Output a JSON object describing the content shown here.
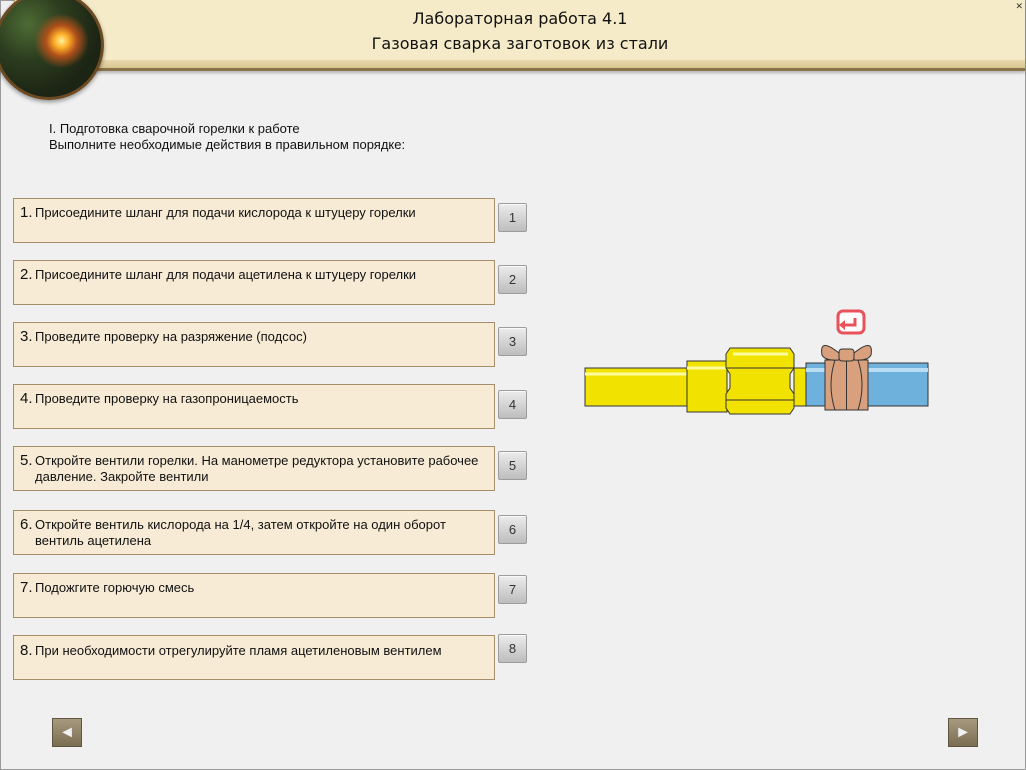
{
  "header": {
    "title_line1": "Лабораторная работа 4.1",
    "title_line2": "Газовая сварка заготовок из стали",
    "close_label": "✕"
  },
  "intro": {
    "line1": "I. Подготовка сварочной горелки к работе",
    "line2": "Выполните необходимые действия в правильном порядке:"
  },
  "steps": [
    {
      "num": "1.",
      "text": "Присоедините шланг для подачи кислорода к штуцеру горелки",
      "button": "1"
    },
    {
      "num": "2.",
      "text": "Присоедините шланг для подачи ацетилена к штуцеру горелки",
      "button": "2"
    },
    {
      "num": "3.",
      "text": "Проведите проверку на разряжение (подсос)",
      "button": "3"
    },
    {
      "num": "4.",
      "text": "Проведите проверку на газопроницаемость",
      "button": "4"
    },
    {
      "num": "5.",
      "text": "Откройте вентили горелки. На манометре редуктора установите рабочее давление. Закройте вентили",
      "button": "5"
    },
    {
      "num": "6.",
      "text": "Откройте вентиль кислорода на 1/4, затем откройте на один оборот вентиль ацетилена",
      "button": "6"
    },
    {
      "num": "7.",
      "text": "Подожгите горючую смесь",
      "button": "7"
    },
    {
      "num": "8.",
      "text": "При необходимости отрегулируйте пламя ацетиленовым вентилем",
      "button": "8"
    }
  ],
  "nav": {
    "prev_label": "◄",
    "next_label": "►"
  },
  "colors": {
    "hose_yellow": "#f2e200",
    "pipe_blue": "#6fb1dd",
    "clamp_copper": "#d9a07e",
    "rotate_icon": "#e8525a"
  }
}
